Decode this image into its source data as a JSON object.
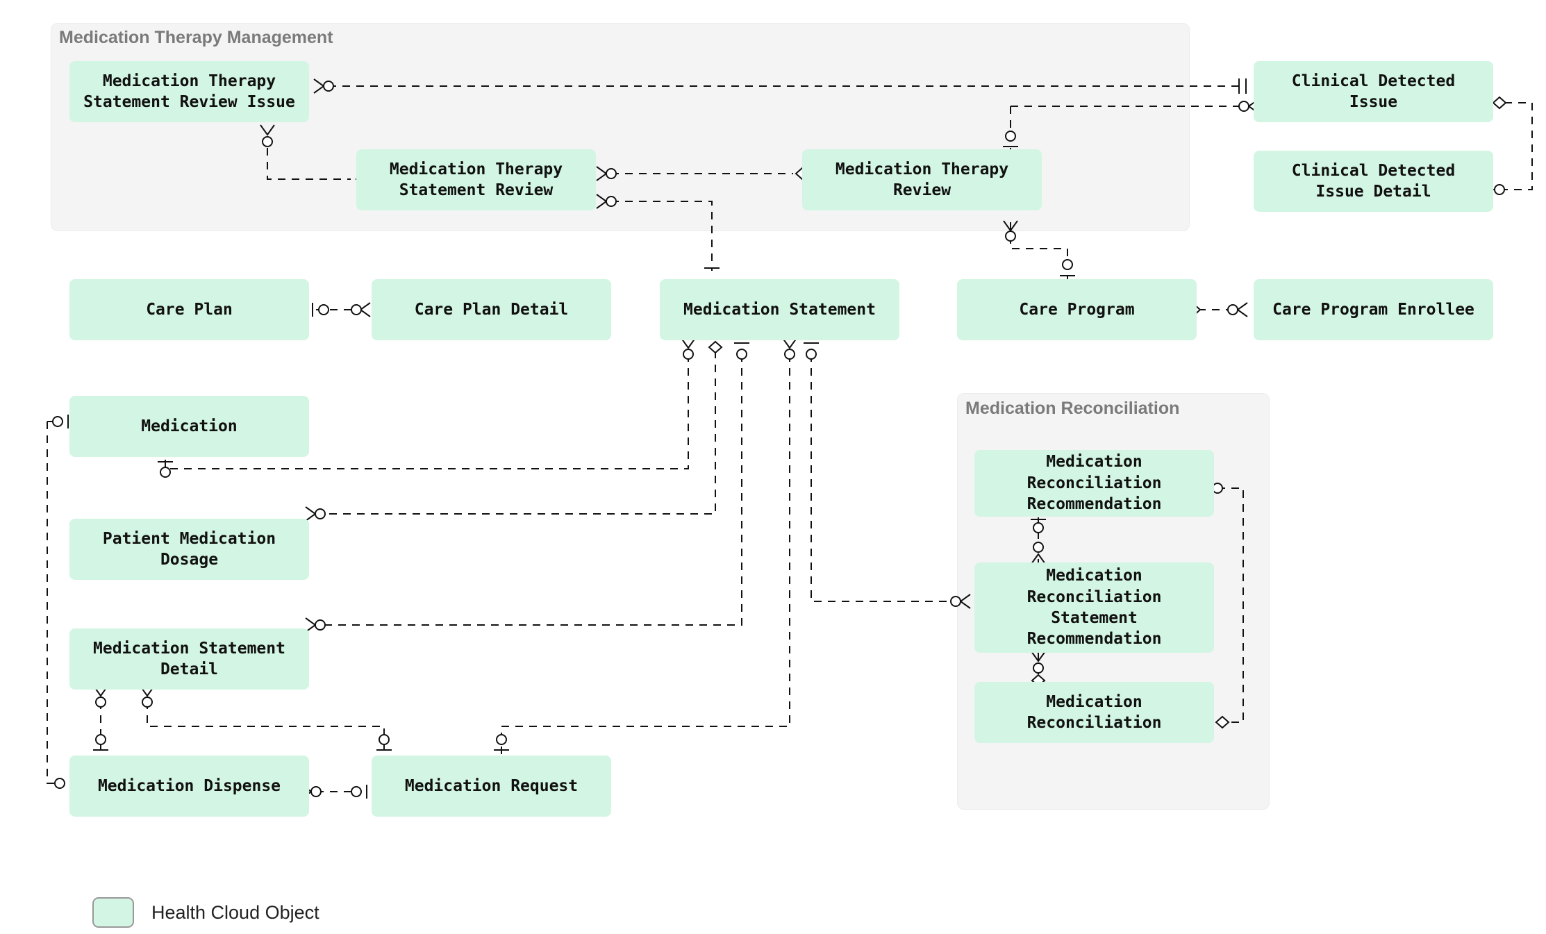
{
  "diagram": {
    "type": "entity-relationship",
    "background": "#ffffff",
    "entity_fill": "#d3f5e3",
    "group_fill": "#f4f4f4",
    "group_title_color": "#7a7a7a",
    "line_color": "#111111",
    "line_style": "dashed"
  },
  "groups": [
    {
      "id": "mtm",
      "title": "Medication Therapy Management"
    },
    {
      "id": "mrecon",
      "title": "Medication Reconciliation"
    }
  ],
  "entities": [
    {
      "id": "mtsri",
      "label": "Medication Therapy\nStatement Review Issue",
      "group": "mtm"
    },
    {
      "id": "mtsr",
      "label": "Medication Therapy\nStatement Review",
      "group": "mtm"
    },
    {
      "id": "mtr",
      "label": "Medication Therapy\nReview",
      "group": "mtm"
    },
    {
      "id": "cdi",
      "label": "Clinical Detected\nIssue",
      "group": ""
    },
    {
      "id": "cdid",
      "label": "Clinical Detected\nIssue Detail",
      "group": ""
    },
    {
      "id": "cplan",
      "label": "Care Plan",
      "group": ""
    },
    {
      "id": "cpd",
      "label": "Care Plan Detail",
      "group": ""
    },
    {
      "id": "mstat",
      "label": "Medication Statement",
      "group": ""
    },
    {
      "id": "cprog",
      "label": "Care Program",
      "group": ""
    },
    {
      "id": "cpe",
      "label": "Care Program Enrollee",
      "group": ""
    },
    {
      "id": "med",
      "label": "Medication",
      "group": ""
    },
    {
      "id": "pmd",
      "label": "Patient Medication\nDosage",
      "group": ""
    },
    {
      "id": "msd",
      "label": "Medication Statement\nDetail",
      "group": ""
    },
    {
      "id": "mdisp",
      "label": "Medication Dispense",
      "group": ""
    },
    {
      "id": "mreq",
      "label": "Medication Request",
      "group": ""
    },
    {
      "id": "mrr",
      "label": "Medication\nReconciliation\nRecommendation",
      "group": "mrecon"
    },
    {
      "id": "mrsr",
      "label": "Medication\nReconciliation\nStatement\nRecommendation",
      "group": "mrecon"
    },
    {
      "id": "mrec",
      "label": "Medication\nReconciliation",
      "group": "mrecon"
    }
  ],
  "relationships": [
    {
      "from": "mtsri",
      "to": "cdi",
      "from_marker": "crowfoot-zero",
      "to_marker": "one-one"
    },
    {
      "from": "mtsri",
      "to": "mtsr",
      "from_marker": "crowfoot-zero",
      "to_marker": "diamond"
    },
    {
      "from": "mtsr",
      "to": "mtr",
      "from_marker": "crowfoot-zero",
      "to_marker": "diamond"
    },
    {
      "from": "mtsr",
      "to": "mstat",
      "from_marker": "crowfoot-zero",
      "to_marker": "one-one"
    },
    {
      "from": "mtr",
      "to": "cdi",
      "from_marker": "zero-one",
      "to_marker": "crowfoot-zero"
    },
    {
      "from": "mtr",
      "to": "cprog",
      "from_marker": "crowfoot-zero",
      "to_marker": "zero-one"
    },
    {
      "from": "cdi",
      "to": "cdid",
      "from_marker": "diamond",
      "to_marker": "crowfoot-zero"
    },
    {
      "from": "cplan",
      "to": "cpd",
      "from_marker": "zero-one",
      "to_marker": "crowfoot-zero"
    },
    {
      "from": "cprog",
      "to": "cpe",
      "from_marker": "diamond",
      "to_marker": "crowfoot-zero"
    },
    {
      "from": "med",
      "to": "mstat",
      "from_marker": "zero-one",
      "to_marker": "crowfoot-zero"
    },
    {
      "from": "med",
      "to": "mdisp",
      "from_marker": "zero-one",
      "to_marker": "crowfoot-zero"
    },
    {
      "from": "pmd",
      "to": "mstat",
      "from_marker": "crowfoot-zero",
      "to_marker": "diamond"
    },
    {
      "from": "msd",
      "to": "mstat",
      "from_marker": "crowfoot-zero",
      "to_marker": "zero-one"
    },
    {
      "from": "msd",
      "to": "mdisp",
      "from_marker": "crowfoot-zero",
      "to_marker": "zero-one"
    },
    {
      "from": "msd",
      "to": "mreq",
      "from_marker": "crowfoot-zero",
      "to_marker": "zero-one"
    },
    {
      "from": "mstat",
      "to": "mreq",
      "from_marker": "crowfoot-zero",
      "to_marker": "zero-one"
    },
    {
      "from": "mstat",
      "to": "mrsr",
      "from_marker": "zero-one",
      "to_marker": "crowfoot-zero"
    },
    {
      "from": "mdisp",
      "to": "mreq",
      "from_marker": "crowfoot-zero",
      "to_marker": "zero-one"
    },
    {
      "from": "mrr",
      "to": "mrsr",
      "from_marker": "zero-one",
      "to_marker": "crowfoot-zero"
    },
    {
      "from": "mrr",
      "to": "mrec",
      "from_marker": "crowfoot-zero",
      "to_marker": "diamond"
    },
    {
      "from": "mrsr",
      "to": "mrec",
      "from_marker": "crowfoot-zero",
      "to_marker": "diamond"
    }
  ],
  "legend": {
    "swatch_color": "#d3f5e3",
    "label": "Health Cloud Object"
  }
}
